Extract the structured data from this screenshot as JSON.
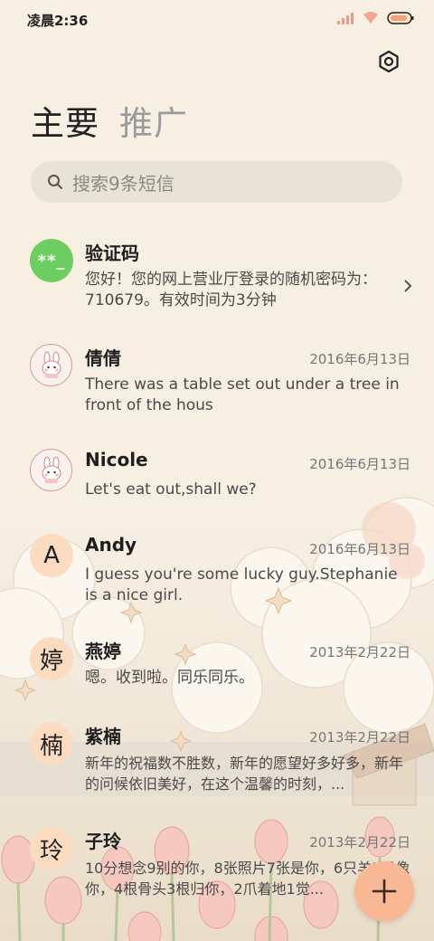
{
  "status_bar": {
    "time": "凌晨2:36"
  },
  "tabs": [
    {
      "label": "主要",
      "active": true
    },
    {
      "label": "推广",
      "active": false
    }
  ],
  "search": {
    "placeholder": "搜索9条短信"
  },
  "messages": [
    {
      "avatar_type": "green",
      "avatar_text": "**_",
      "name": "验证码",
      "date": "",
      "snippet": "您好！您的网上营业厅登录的随机密码为：710679。有效时间为3分钟",
      "has_chevron": true
    },
    {
      "avatar_type": "bunny",
      "avatar_text": "",
      "name": "倩倩",
      "date": "2016年6月13日",
      "snippet": "There was a table set out under a tree in front of the hous"
    },
    {
      "avatar_type": "bunny",
      "avatar_text": "",
      "name": "Nicole",
      "date": "2016年6月13日",
      "snippet": "Let's eat out,shall we?"
    },
    {
      "avatar_type": "letter",
      "avatar_text": "A",
      "name": "Andy",
      "date": "2016年6月13日",
      "snippet": "I guess you're some lucky guy.Stephanie is a nice girl."
    },
    {
      "avatar_type": "letter",
      "avatar_text": "婷",
      "name": "燕婷",
      "date": "2013年2月22日",
      "snippet": "嗯。收到啦。同乐同乐。"
    },
    {
      "avatar_type": "letter",
      "avatar_text": "楠",
      "name": "紫楠",
      "date": "2013年2月22日",
      "snippet": "新年的祝福数不胜数，新年的愿望好多好多，新年的问候依旧美好，在这个温馨的时刻，..."
    },
    {
      "avatar_type": "letter",
      "avatar_text": "玲",
      "name": "子玲",
      "date": "2013年2月22日",
      "snippet": "10分想念9别的你，8张照片7张是你，6只羊5只像你，4根骨头3根归你，2爪着地1觉..."
    }
  ],
  "icons": {
    "signal": "signal-icon",
    "wifi": "wifi-icon",
    "battery": "battery-icon",
    "settings": "gear-icon",
    "search": "search-icon",
    "compose": "plus-icon"
  },
  "colors": {
    "background": "#f7efe2",
    "accent": "#f8b893",
    "avatar_letter_bg": "#fbdcc0",
    "verify_avatar": "#6dce60"
  }
}
